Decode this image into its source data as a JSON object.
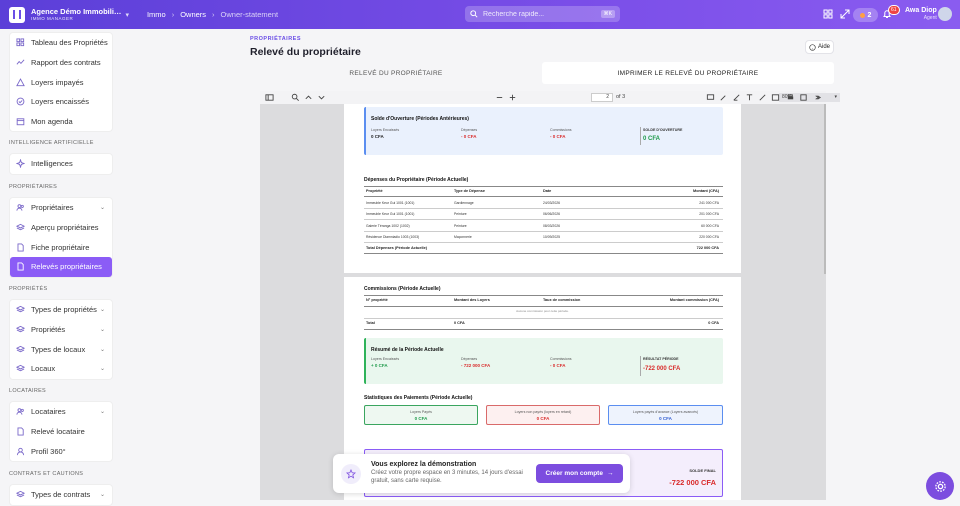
{
  "topbar": {
    "brand_name": "Agence Démo Immobili…",
    "brand_sub": "IMMO MANAGER",
    "breadcrumbs": [
      "Immo",
      "Owners",
      "Owner-statement"
    ],
    "search_placeholder": "Recherche rapide...",
    "search_shortcut": "⌘K",
    "notif_count": "2",
    "bell_badge": "61",
    "user_name": "Awa Diop",
    "user_role": "Agent"
  },
  "sidebar": {
    "group0": [
      {
        "label": "Tableau des Propriétés",
        "icon": "grid-icon"
      },
      {
        "label": "Rapport des contrats",
        "icon": "chart-line-icon"
      },
      {
        "label": "Loyers impayés",
        "icon": "warning-icon"
      },
      {
        "label": "Loyers encaissés",
        "icon": "check-circle-icon"
      },
      {
        "label": "Mon agenda",
        "icon": "calendar-icon"
      }
    ],
    "sections": [
      "INTELLIGENCE ARTIFICIELLE",
      "PROPRIÉTAIRES",
      "PROPRIÉTÉS",
      "LOCATAIRES",
      "CONTRATS ET CAUTIONS"
    ],
    "ai": [
      {
        "label": "Intelligences",
        "icon": "sparkle-icon"
      }
    ],
    "owners": [
      {
        "label": "Propriétaires",
        "icon": "users-icon",
        "dropdown": true
      },
      {
        "label": "Aperçu propriétaires",
        "icon": "layers-icon"
      },
      {
        "label": "Fiche propriétaire",
        "icon": "document-icon"
      },
      {
        "label": "Relevés propriétaires",
        "icon": "document-icon",
        "active": true
      }
    ],
    "props": [
      {
        "label": "Types de propriétés",
        "icon": "layers-icon",
        "dropdown": true
      },
      {
        "label": "Propriétés",
        "icon": "layers-icon",
        "dropdown": true
      },
      {
        "label": "Types de locaux",
        "icon": "layers-icon",
        "dropdown": true
      },
      {
        "label": "Locaux",
        "icon": "layers-icon",
        "dropdown": true
      }
    ],
    "tenants": [
      {
        "label": "Locataires",
        "icon": "users-icon",
        "dropdown": true
      },
      {
        "label": "Relevé locataire",
        "icon": "document-icon"
      },
      {
        "label": "Profil 360°",
        "icon": "profile-icon"
      }
    ],
    "contracts": [
      {
        "label": "Types de contrats",
        "icon": "layers-icon",
        "dropdown": true
      }
    ]
  },
  "main": {
    "eyebrow": "PROPRIÉTAIRES",
    "title": "Relevé du propriétaire",
    "help": "Aide",
    "tabs": [
      "RELEVÉ DU PROPRIÉTAIRE",
      "IMPRIMER LE RELEVÉ DU PROPRIÉTAIRE"
    ]
  },
  "pdf": {
    "page_current": "2",
    "page_total": "of 3",
    "zoom": "80%"
  },
  "doc": {
    "opening": {
      "title": "Solde d'Ouverture (Périodes Antérieures)",
      "l1": "Loyers Encaissés",
      "v1": "0 CFA",
      "l2": "Dépenses",
      "v2": "- 0 CFA",
      "l3": "Commissions",
      "v3": "- 0 CFA",
      "l4": "SOLDE D'OUVERTURE",
      "v4": "0 CFA"
    },
    "expenses": {
      "title": "Dépenses du Propriétaire (Période Actuelle)",
      "headers": [
        "Propriété",
        "Type de Dépense",
        "Date",
        "Montant (CFA)"
      ],
      "rows": [
        [
          "Immeuble Keur Gui 1001 (1001)",
          "Gardiennage",
          "24/03/2026",
          "241 000 CFA"
        ],
        [
          "Immeuble Keur Gui 1001 (1001)",
          "Peinture",
          "06/06/2026",
          "201 000 CFA"
        ],
        [
          "Galerie Téranga 1002 (1002)",
          "Peinture",
          "08/03/2026",
          "60 000 CFA"
        ],
        [
          "Résidence Diamniadio 1003 (1003)",
          "Maçonnerie",
          "10/09/2025",
          "220 000 CFA"
        ]
      ],
      "total_label": "Total Dépenses (Période Actuelle)",
      "total": "722 000 CFA"
    },
    "commissions": {
      "title": "Commissions (Période Actuelle)",
      "headers": [
        "N° propriété",
        "Montant des Loyers",
        "Taux de commission",
        "Montant commission (CFA)"
      ],
      "empty": "Aucune commission pour cette période.",
      "total_label": "Total",
      "total_loyers": "0 CFA",
      "total_comm": "0 CFA"
    },
    "summary": {
      "title": "Résumé de la Période Actuelle",
      "l1": "Loyers Encaissés",
      "v1": "+ 0 CFA",
      "l2": "Dépenses",
      "v2": "- 722 000 CFA",
      "l3": "Commissions",
      "v3": "- 0 CFA",
      "l4": "RÉSULTAT PÉRIODE",
      "v4": "-722 000 CFA"
    },
    "payments": {
      "title": "Statistiques des Paiements (Période Actuelle)",
      "boxes": [
        {
          "label": "Loyers Payés",
          "value": "0 CFA"
        },
        {
          "label": "Loyers non payés (loyers en retard)",
          "value": "0 CFA"
        },
        {
          "label": "Loyers payés d'avance (Loyers avancés)",
          "value": "0 CFA"
        }
      ]
    },
    "final": {
      "label": "SOLDE FINAL",
      "value": "-722 000 CFA"
    }
  },
  "demo": {
    "title": "Vous explorez la démonstration",
    "text": "Créez votre propre espace en 3 minutes, 14 jours d'essai gratuit, sans carte requise.",
    "button": "Créer mon compte"
  },
  "colors": {
    "accent": "#7c4ddf",
    "blue_box": "#eaf1fd",
    "green_box": "#e9f7ee",
    "red": "#d92b2b",
    "green": "#1e9a4a"
  }
}
